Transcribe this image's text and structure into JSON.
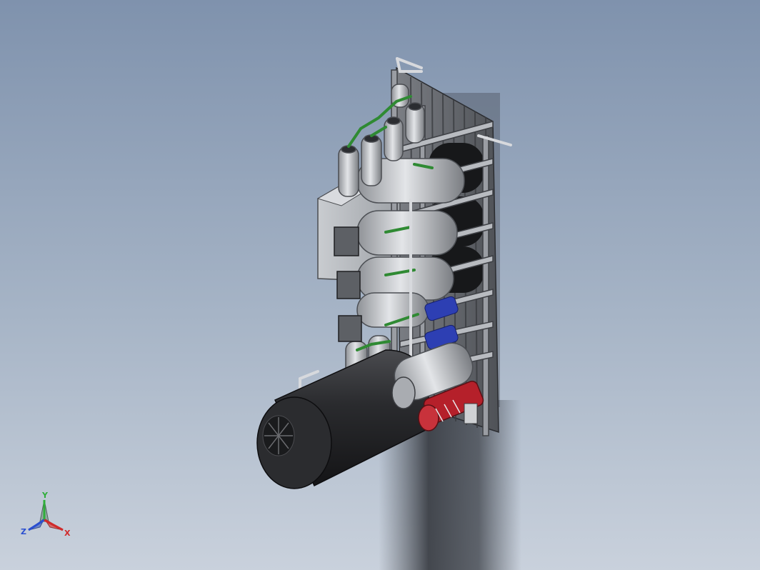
{
  "viewport": {
    "background_top": "#7f92ad",
    "background_bottom": "#c9d1dc"
  },
  "model": {
    "name_icon": "water-treatment-skid-3d-model",
    "accent_colors": {
      "pipe_green": "#2f8a33",
      "pump_red": "#b5202a",
      "filter_blue": "#2d3fb3",
      "tank_black": "#1e1e20",
      "frame_gray": "#6d7075"
    }
  },
  "triad": {
    "icon": "view-orientation-triad-icon",
    "y_label": "Y",
    "z_label": "Z",
    "x_label": "X",
    "colors": {
      "x": "#d02a2a",
      "y": "#2fae3a",
      "z": "#2a4fd0"
    }
  }
}
